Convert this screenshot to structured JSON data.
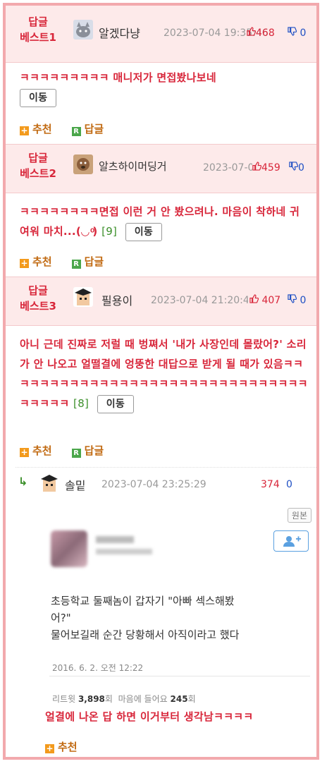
{
  "best_comments": [
    {
      "badge_line1": "답글",
      "badge_line2": "베스트1",
      "nickname": "알겠다냥",
      "date": "2023-07-04 19:35:46",
      "up": "468",
      "down": "0",
      "text": "ㅋㅋㅋㅋㅋㅋㅋㅋㅋ 매니저가 면접봤나보네",
      "reply_count": "",
      "move_label": "이동",
      "recommend_label": "추천",
      "reply_label": "답글"
    },
    {
      "badge_line1": "답글",
      "badge_line2": "베스트2",
      "nickname": "알츠하이머딩거",
      "date": "2023-07-04 19:57:28",
      "up": "459",
      "down": "0",
      "text": "ㅋㅋㅋㅋㅋㅋㅋㅋ면접 이런 거 안 봤으려나. 마음이 착하네 귀여워 마치...(◡ ͦ)",
      "reply_count": "[9]",
      "move_label": "이동",
      "recommend_label": "추천",
      "reply_label": "답글"
    },
    {
      "badge_line1": "답글",
      "badge_line2": "베스트3",
      "nickname": "필용이",
      "date": "2023-07-04 21:20:44",
      "up": "407",
      "down": "0",
      "text": "아니 근데 진짜로 저럴 때 벙쪄서 '내가 사장인데 몰랐어?' 소리가 안 나오고 얼떨결에 엉뚱한 대답으로 받게 될 때가 있음ㅋㅋㅋㅋㅋㅋㅋㅋㅋㅋㅋㅋㅋㅋㅋㅋㅋㅋㅋㅋㅋㅋㅋㅋㅋㅋㅋㅋㅋㅋㅋㅋㅋㅋㅋㅋ",
      "reply_count": "[8]",
      "move_label": "이동",
      "recommend_label": "추천",
      "reply_label": "답글"
    }
  ],
  "reply": {
    "arrow": "↳",
    "nickname": "솔밑",
    "date": "2023-07-04 23:25:29",
    "up": "374",
    "down": "0",
    "origin_label": "원본",
    "tweet_text_line1": "초등학교 둘째놈이 갑자기  \"아빠  섹스해봤",
    "tweet_text_line2": "어?\"",
    "tweet_text_line3": "물어보길래 순간 당황해서  아직이라고 했다",
    "tweet_date": "2016. 6. 2. 오전 12:22",
    "retweets_label": "리트윗",
    "retweets": "3,898",
    "retweets_unit": "회",
    "likes_label": "마음에 들어요",
    "likes": "245",
    "likes_unit": "회",
    "text": "얼결에 나온 답 하면 이거부터 생각남ㅋㅋㅋㅋ",
    "recommend_label": "추천"
  },
  "colors": {
    "accent_red": "#d8263a",
    "border_pink": "#f2a9ad",
    "header_bg": "#fdeaea",
    "down_blue": "#1e4fc4",
    "count_green": "#3b8f2a"
  },
  "icons": [
    "thumbs-up-icon",
    "thumbs-down-icon",
    "plus-icon",
    "reply-r-icon",
    "reply-arrow-icon",
    "follow-user-icon"
  ]
}
